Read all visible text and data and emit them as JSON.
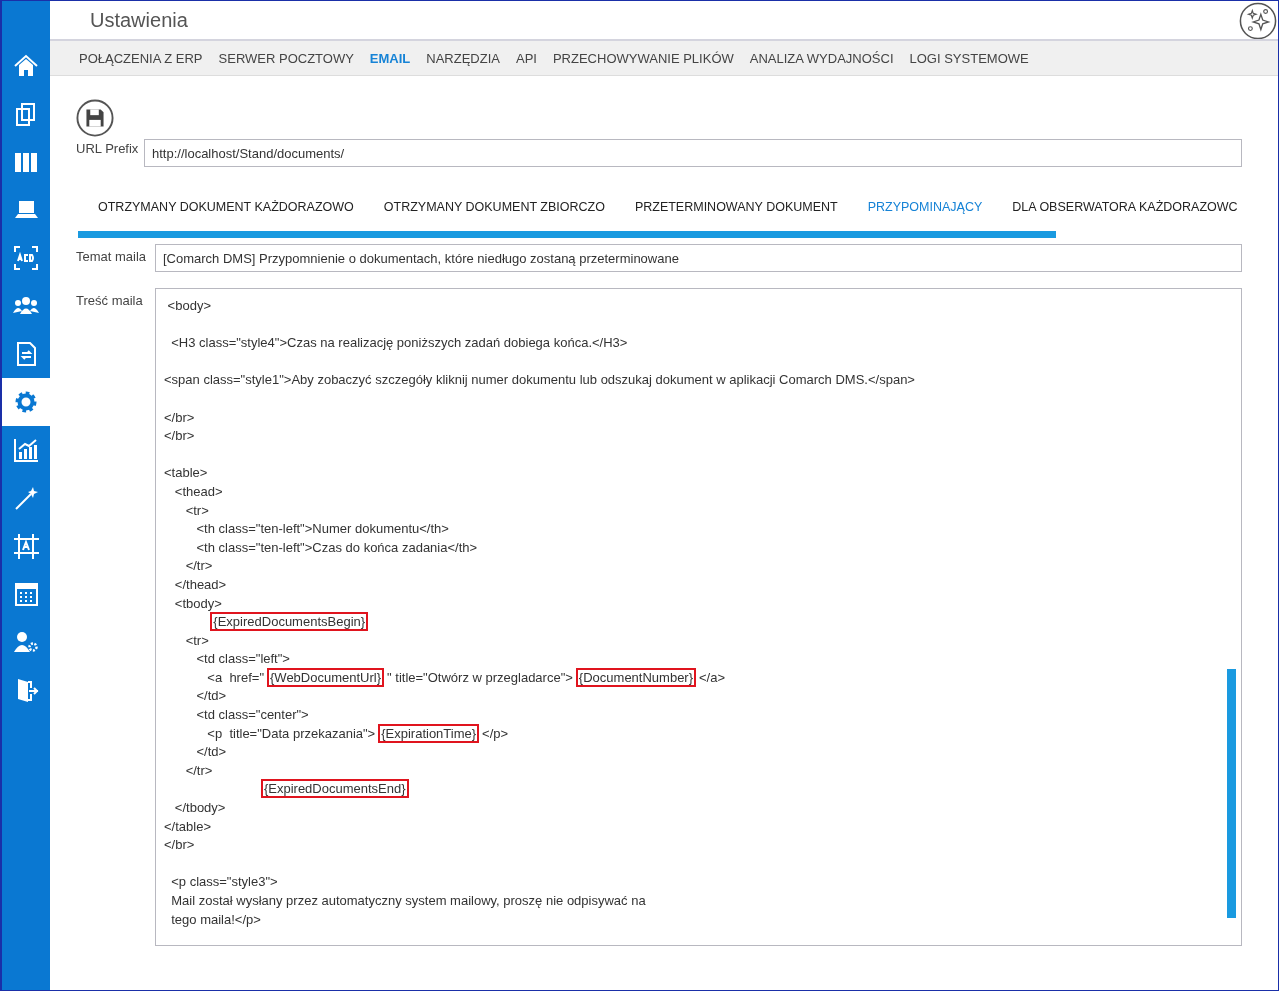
{
  "window": {
    "title": "Ustawienia"
  },
  "sidebar": {
    "items": [
      {
        "selected": false
      },
      {
        "selected": false
      },
      {
        "selected": false
      },
      {
        "selected": false
      },
      {
        "selected": false
      },
      {
        "selected": false
      },
      {
        "selected": false
      },
      {
        "selected": true
      },
      {
        "selected": false
      },
      {
        "selected": false
      },
      {
        "selected": false
      },
      {
        "selected": false
      },
      {
        "selected": false
      },
      {
        "selected": false
      }
    ]
  },
  "nav_tabs": [
    {
      "label": "POŁĄCZENIA Z ERP",
      "selected": false
    },
    {
      "label": "SERWER POCZTOWY",
      "selected": false
    },
    {
      "label": "EMAIL",
      "selected": true
    },
    {
      "label": "NARZĘDZIA",
      "selected": false
    },
    {
      "label": "API",
      "selected": false
    },
    {
      "label": "PRZECHOWYWANIE PLIKÓW",
      "selected": false
    },
    {
      "label": "ANALIZA WYDAJNOŚCI",
      "selected": false
    },
    {
      "label": "LOGI SYSTEMOWE",
      "selected": false
    }
  ],
  "url_prefix": {
    "label": "URL Prefix",
    "value": "http://localhost/Stand/documents/"
  },
  "mail_tabs": [
    {
      "label": "OTRZYMANY DOKUMENT KAŻDORAZOWO",
      "selected": false
    },
    {
      "label": "OTRZYMANY DOKUMENT ZBIORCZO",
      "selected": false
    },
    {
      "label": "PRZETERMINOWANY DOKUMENT",
      "selected": false
    },
    {
      "label": "PRZYPOMINAJĄCY",
      "selected": true
    },
    {
      "label": "DLA OBSERWATORA KAŻDORAZOWC",
      "selected": false
    }
  ],
  "subject": {
    "label": "Temat maila",
    "value": "[Comarch DMS] Przypomnienie o dokumentach, które niedługo zostaną przeterminowane"
  },
  "body": {
    "label": "Treść maila",
    "lines": [
      {
        "kind": "code",
        "segments": [
          {
            "text": " <body>",
            "marked": false
          }
        ]
      },
      {
        "kind": "blank"
      },
      {
        "kind": "code",
        "segments": [
          {
            "text": "  <H3 class=\"style4\">Czas na realizację poniższych zadań dobiega końca.</H3>",
            "marked": false
          }
        ]
      },
      {
        "kind": "blank"
      },
      {
        "kind": "code",
        "segments": [
          {
            "text": "<span class=\"style1\">Aby zobaczyć szczegóły kliknij numer dokumentu lub odszukaj dokument w aplikacji Comarch DMS.</span>",
            "marked": false
          }
        ]
      },
      {
        "kind": "blank"
      },
      {
        "kind": "code",
        "segments": [
          {
            "text": "</br>",
            "marked": false
          }
        ]
      },
      {
        "kind": "code",
        "segments": [
          {
            "text": "</br>",
            "marked": false
          }
        ]
      },
      {
        "kind": "blank"
      },
      {
        "kind": "code",
        "segments": [
          {
            "text": "<table>",
            "marked": false
          }
        ]
      },
      {
        "kind": "code",
        "segments": [
          {
            "text": "   <thead>",
            "marked": false
          }
        ]
      },
      {
        "kind": "code",
        "segments": [
          {
            "text": "      <tr>",
            "marked": false
          }
        ]
      },
      {
        "kind": "code",
        "segments": [
          {
            "text": "         <th class=\"ten-left\">Numer dokumentu</th>",
            "marked": false
          }
        ]
      },
      {
        "kind": "code",
        "segments": [
          {
            "text": "         <th class=\"ten-left\">Czas do końca zadania</th>",
            "marked": false
          }
        ]
      },
      {
        "kind": "code",
        "segments": [
          {
            "text": "      </tr>",
            "marked": false
          }
        ]
      },
      {
        "kind": "code",
        "segments": [
          {
            "text": "   </thead>",
            "marked": false
          }
        ]
      },
      {
        "kind": "code",
        "segments": [
          {
            "text": "   <tbody>",
            "marked": false
          }
        ]
      },
      {
        "kind": "code",
        "segments": [
          {
            "text": "            {ExpiredDocumentsBegin}",
            "marked": true
          }
        ]
      },
      {
        "kind": "code",
        "segments": [
          {
            "text": "      <tr>",
            "marked": false
          }
        ]
      },
      {
        "kind": "code",
        "segments": [
          {
            "text": "         <td class=\"left\">",
            "marked": false
          }
        ]
      },
      {
        "kind": "code",
        "segments": [
          {
            "text": "            <a  href=\"",
            "marked": false
          },
          {
            "text": "{WebDocumentUrl}",
            "marked": true
          },
          {
            "text": "\" title=\"Otwórz w przegladarce\">",
            "marked": false
          },
          {
            "text": "{DocumentNumber}",
            "marked": true
          },
          {
            "text": "</a>",
            "marked": false
          }
        ]
      },
      {
        "kind": "code",
        "segments": [
          {
            "text": "         </td>",
            "marked": false
          }
        ]
      },
      {
        "kind": "code",
        "segments": [
          {
            "text": "         <td class=\"center\">",
            "marked": false
          }
        ]
      },
      {
        "kind": "code",
        "segments": [
          {
            "text": "            <p  title=\"Data przekazania\">",
            "marked": false
          },
          {
            "text": "{ExpirationTime}",
            "marked": true
          },
          {
            "text": "</p>",
            "marked": false
          }
        ]
      },
      {
        "kind": "code",
        "segments": [
          {
            "text": "         </td>",
            "marked": false
          }
        ]
      },
      {
        "kind": "code",
        "segments": [
          {
            "text": "      </tr>",
            "marked": false
          }
        ]
      },
      {
        "kind": "code",
        "segments": [
          {
            "text": "                          {ExpiredDocumentsEnd}",
            "marked": true
          }
        ]
      },
      {
        "kind": "code",
        "segments": [
          {
            "text": "   </tbody>",
            "marked": false
          }
        ]
      },
      {
        "kind": "code",
        "segments": [
          {
            "text": "</table>",
            "marked": false
          }
        ]
      },
      {
        "kind": "code",
        "segments": [
          {
            "text": "</br>",
            "marked": false
          }
        ]
      },
      {
        "kind": "blank"
      },
      {
        "kind": "code",
        "segments": [
          {
            "text": "  <p class=\"style3\">",
            "marked": false
          }
        ]
      },
      {
        "kind": "code",
        "segments": [
          {
            "text": "  Mail został wysłany przez automatyczny system mailowy, proszę nie odpisywać na",
            "marked": false
          }
        ]
      },
      {
        "kind": "code",
        "segments": [
          {
            "text": "  tego maila!</p>",
            "marked": false
          }
        ]
      }
    ]
  }
}
